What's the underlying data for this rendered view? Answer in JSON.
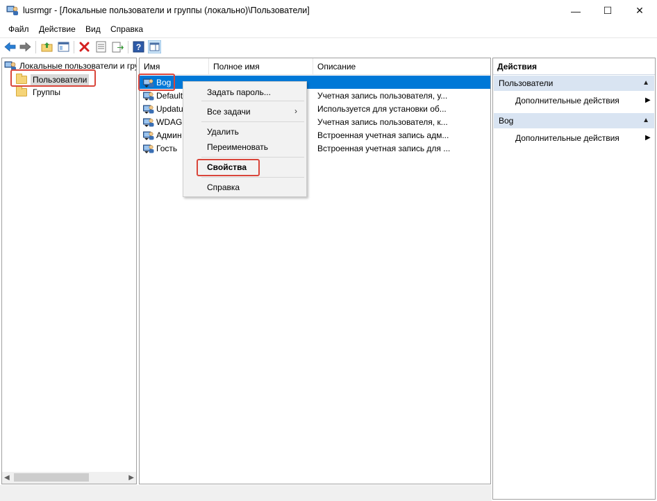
{
  "window": {
    "title": "lusrmgr - [Локальные пользователи и группы (локально)\\Пользователи]",
    "minimize_symbol": "—",
    "maximize_symbol": "☐",
    "close_symbol": "✕"
  },
  "menu": [
    "Файл",
    "Действие",
    "Вид",
    "Справка"
  ],
  "toolbar": {
    "buttons": [
      "back-icon",
      "forward-icon",
      "up-folder-icon",
      "show-hide-tree-icon",
      "delete-icon",
      "properties-icon",
      "export-list-icon",
      "help-icon",
      "show-hide-action-pane-icon"
    ]
  },
  "tree": {
    "root": "Локальные пользователи и гру",
    "nodes": [
      {
        "label": "Пользователи",
        "selected": true
      },
      {
        "label": "Группы",
        "selected": false
      }
    ]
  },
  "list": {
    "columns": [
      "Имя",
      "Полное имя",
      "Описание"
    ],
    "rows": [
      {
        "name": "Bog",
        "full": "",
        "desc": "",
        "selected": true
      },
      {
        "name": "Default",
        "full": "",
        "desc": "Учетная запись пользователя, у...",
        "selected": false
      },
      {
        "name": "Updatu",
        "full": "",
        "desc": "Используется для установки об...",
        "selected": false
      },
      {
        "name": "WDAGU",
        "full": "",
        "desc": "Учетная запись пользователя, к...",
        "selected": false
      },
      {
        "name": "Админ",
        "full": "",
        "desc": "Встроенная учетная запись адм...",
        "selected": false
      },
      {
        "name": "Гость",
        "full": "",
        "desc": "Встроенная учетная запись для ...",
        "selected": false
      }
    ]
  },
  "context_menu": {
    "set_password": "Задать пароль...",
    "all_tasks": "Все задачи",
    "all_tasks_arrow": "›",
    "delete": "Удалить",
    "rename": "Переименовать",
    "properties": "Свойства",
    "help": "Справка"
  },
  "actions": {
    "header": "Действия",
    "groups": [
      {
        "title": "Пользователи",
        "item": "Дополнительные действия"
      },
      {
        "title": "Bog",
        "item": "Дополнительные действия"
      }
    ]
  },
  "colors": {
    "selection": "#0078d7",
    "highlight": "#d9453a",
    "action_group_bg": "#d9e4f2"
  }
}
